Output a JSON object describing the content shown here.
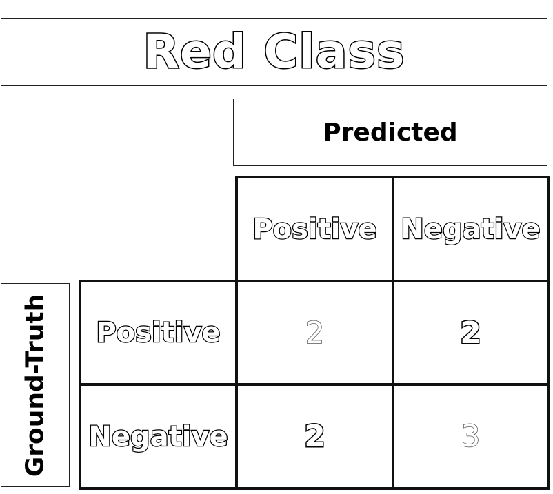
{
  "title": "Red Class",
  "predicted_label": "Predicted",
  "ground_truth_label": "Ground-Truth",
  "columns": [
    "Positive",
    "Negative"
  ],
  "rows": [
    {
      "label": "Positive",
      "values": [
        "2",
        "2"
      ]
    },
    {
      "label": "Negative",
      "values": [
        "2",
        "3"
      ]
    }
  ]
}
